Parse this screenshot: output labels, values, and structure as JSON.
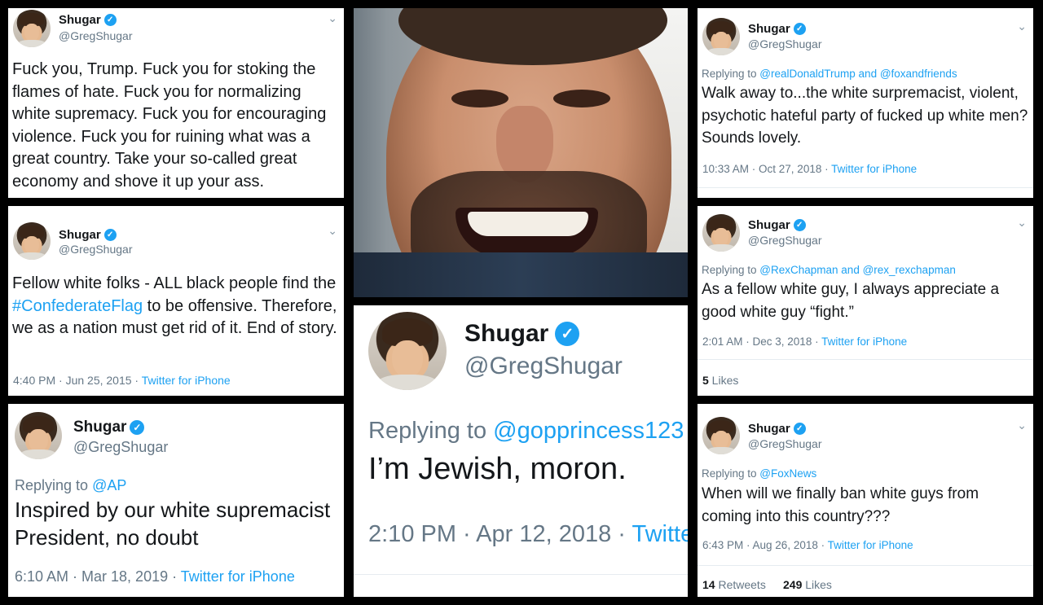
{
  "user": {
    "name": "Shugar",
    "handle": "@GregShugar",
    "verified_glyph": "✓"
  },
  "colors": {
    "link": "#1da1f2",
    "muted": "#657786",
    "text": "#14171a"
  },
  "tweet1": {
    "text": "Fuck you, Trump. Fuck you for stoking the flames of hate. Fuck you for normalizing white supremacy. Fuck you for encouraging violence. Fuck you for ruining what was a great country. Take your so-called great economy and shove it up your ass."
  },
  "tweet2": {
    "text_before": "Fellow white folks - ALL black people find the ",
    "hashtag": "#ConfederateFlag",
    "text_after": " to be offensive. Therefore, we as a nation must get rid of it. End of story.",
    "time": "4:40 PM · Jun 25, 2015 · ",
    "source": "Twitter for iPhone"
  },
  "tweet3": {
    "reply_prefix": "Replying to ",
    "reply_to": "@AP",
    "text": "Inspired by our white supremacist President, no doubt",
    "time": "6:10 AM · Mar 18, 2019 · ",
    "source": "Twitter for iPhone"
  },
  "tweet4": {
    "reply_prefix": "Replying to ",
    "reply_to": "@gopprincess123",
    "text": "I’m Jewish, moron.",
    "time": "2:10 PM · Apr 12, 2018 · ",
    "source": "Twitter for iPhone"
  },
  "tweet5": {
    "reply_prefix": "Replying to ",
    "reply_to_1": "@realDonaldTrump",
    "reply_and": " and ",
    "reply_to_2": "@foxandfriends",
    "text": "Walk away to...the white surpremacist, violent, psychotic hateful party of fucked up white men? Sounds lovely.",
    "time": "10:33 AM · Oct 27, 2018 · ",
    "source": "Twitter for iPhone"
  },
  "tweet6": {
    "reply_prefix": "Replying to ",
    "reply_to_1": "@RexChapman",
    "reply_and": " and ",
    "reply_to_2": "@rex_rexchapman",
    "text": "As a fellow white guy, I always appreciate a good white guy “fight.”",
    "time": "2:01 AM · Dec 3, 2018 · ",
    "source": "Twitter for iPhone",
    "likes_count": "5",
    "likes_label": " Likes"
  },
  "tweet7": {
    "reply_prefix": "Replying to ",
    "reply_to": "@FoxNews",
    "text": "When will we finally ban white guys from coming into this country???",
    "time": "6:43 PM · Aug 26, 2018 · ",
    "source": "Twitter for iPhone",
    "retweets_count": "14",
    "retweets_label": " Retweets",
    "likes_count": "249",
    "likes_label": " Likes"
  }
}
